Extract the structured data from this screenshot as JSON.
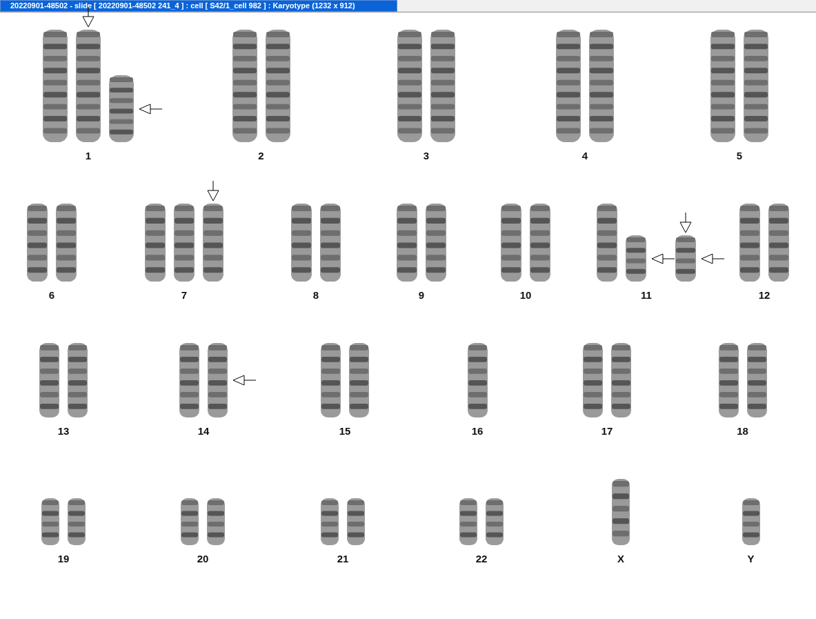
{
  "window": {
    "title": "20220901-48502 - slide [ 20220901-48502 241_4 ] : cell [ S42/1_cell 982 ] : Karyotype  (1232 x 912)"
  },
  "rows": [
    {
      "groups": [
        {
          "label": "1",
          "chromosomes": [
            {
              "kind": "full",
              "arrow_down": false,
              "arrow_left": false
            },
            {
              "kind": "full",
              "arrow_down": true,
              "arrow_left": false
            },
            {
              "kind": "small",
              "arrow_down": false,
              "arrow_left": true
            }
          ]
        },
        {
          "label": "2",
          "chromosomes": [
            {
              "kind": "full",
              "arrow_down": false,
              "arrow_left": false
            },
            {
              "kind": "full",
              "arrow_down": false,
              "arrow_left": false
            }
          ]
        },
        {
          "label": "3",
          "chromosomes": [
            {
              "kind": "full",
              "arrow_down": false,
              "arrow_left": false
            },
            {
              "kind": "full",
              "arrow_down": false,
              "arrow_left": false
            }
          ]
        },
        {
          "label": "4",
          "chromosomes": [
            {
              "kind": "full",
              "arrow_down": false,
              "arrow_left": false
            },
            {
              "kind": "full",
              "arrow_down": false,
              "arrow_left": false
            }
          ]
        },
        {
          "label": "5",
          "chromosomes": [
            {
              "kind": "full",
              "arrow_down": false,
              "arrow_left": false
            },
            {
              "kind": "full",
              "arrow_down": false,
              "arrow_left": false
            }
          ]
        }
      ]
    },
    {
      "groups": [
        {
          "label": "6",
          "chromosomes": [
            {
              "kind": "full",
              "arrow_down": false,
              "arrow_left": false
            },
            {
              "kind": "full",
              "arrow_down": false,
              "arrow_left": false
            }
          ]
        },
        {
          "label": "7",
          "chromosomes": [
            {
              "kind": "full",
              "arrow_down": false,
              "arrow_left": false
            },
            {
              "kind": "full",
              "arrow_down": false,
              "arrow_left": false
            },
            {
              "kind": "full",
              "arrow_down": true,
              "arrow_left": false
            }
          ]
        },
        {
          "label": "8",
          "chromosomes": [
            {
              "kind": "full",
              "arrow_down": false,
              "arrow_left": false
            },
            {
              "kind": "full",
              "arrow_down": false,
              "arrow_left": false
            }
          ]
        },
        {
          "label": "9",
          "chromosomes": [
            {
              "kind": "full",
              "arrow_down": false,
              "arrow_left": false
            },
            {
              "kind": "full",
              "arrow_down": false,
              "arrow_left": false
            }
          ]
        },
        {
          "label": "10",
          "chromosomes": [
            {
              "kind": "full",
              "arrow_down": false,
              "arrow_left": false
            },
            {
              "kind": "full",
              "arrow_down": false,
              "arrow_left": false
            }
          ]
        },
        {
          "label": "11",
          "chromosomes": [
            {
              "kind": "full",
              "arrow_down": false,
              "arrow_left": false
            },
            {
              "kind": "small",
              "arrow_down": false,
              "arrow_left": true
            },
            {
              "kind": "small",
              "arrow_down": true,
              "arrow_left": true
            }
          ]
        },
        {
          "label": "12",
          "chromosomes": [
            {
              "kind": "full",
              "arrow_down": false,
              "arrow_left": false
            },
            {
              "kind": "full",
              "arrow_down": false,
              "arrow_left": false
            }
          ]
        }
      ]
    },
    {
      "groups": [
        {
          "label": "13",
          "chromosomes": [
            {
              "kind": "full",
              "arrow_down": false,
              "arrow_left": false
            },
            {
              "kind": "full",
              "arrow_down": false,
              "arrow_left": false
            }
          ]
        },
        {
          "label": "14",
          "chromosomes": [
            {
              "kind": "full",
              "arrow_down": false,
              "arrow_left": false
            },
            {
              "kind": "full",
              "arrow_down": false,
              "arrow_left": true
            }
          ]
        },
        {
          "label": "15",
          "chromosomes": [
            {
              "kind": "full",
              "arrow_down": false,
              "arrow_left": false
            },
            {
              "kind": "full",
              "arrow_down": false,
              "arrow_left": false
            }
          ]
        },
        {
          "label": "16",
          "chromosomes": [
            {
              "kind": "full",
              "arrow_down": false,
              "arrow_left": false
            }
          ]
        },
        {
          "label": "17",
          "chromosomes": [
            {
              "kind": "full",
              "arrow_down": false,
              "arrow_left": false
            },
            {
              "kind": "full",
              "arrow_down": false,
              "arrow_left": false
            }
          ]
        },
        {
          "label": "18",
          "chromosomes": [
            {
              "kind": "full",
              "arrow_down": false,
              "arrow_left": false
            },
            {
              "kind": "full",
              "arrow_down": false,
              "arrow_left": false
            }
          ]
        }
      ]
    },
    {
      "groups": [
        {
          "label": "19",
          "chromosomes": [
            {
              "kind": "full",
              "arrow_down": false,
              "arrow_left": false
            },
            {
              "kind": "full",
              "arrow_down": false,
              "arrow_left": false
            }
          ]
        },
        {
          "label": "20",
          "chromosomes": [
            {
              "kind": "full",
              "arrow_down": false,
              "arrow_left": false
            },
            {
              "kind": "full",
              "arrow_down": false,
              "arrow_left": false
            }
          ]
        },
        {
          "label": "21",
          "chromosomes": [
            {
              "kind": "full",
              "arrow_down": false,
              "arrow_left": false
            },
            {
              "kind": "full",
              "arrow_down": false,
              "arrow_left": false
            }
          ]
        },
        {
          "label": "22",
          "chromosomes": [
            {
              "kind": "full",
              "arrow_down": false,
              "arrow_left": false
            },
            {
              "kind": "full",
              "arrow_down": false,
              "arrow_left": false
            }
          ]
        },
        {
          "label": "X",
          "chromosomes": [
            {
              "kind": "large",
              "arrow_down": false,
              "arrow_left": false
            }
          ]
        },
        {
          "label": "Y",
          "chromosomes": [
            {
              "kind": "full",
              "arrow_down": false,
              "arrow_left": false
            }
          ]
        }
      ]
    }
  ]
}
